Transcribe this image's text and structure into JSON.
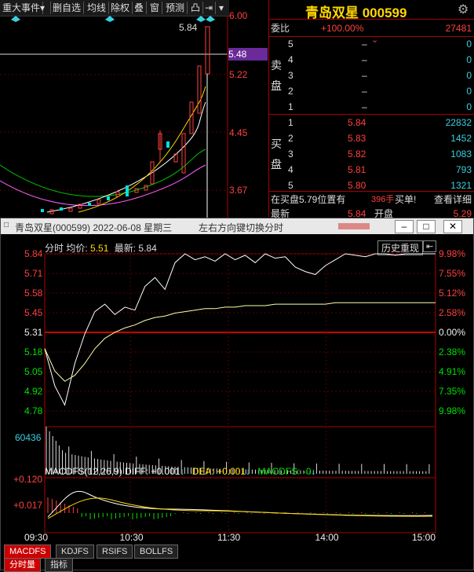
{
  "toolbar": {
    "items": [
      "重大事件",
      "删自选",
      "均线",
      "除权",
      "叠",
      "窗",
      "预测",
      "凸",
      "⇥"
    ]
  },
  "kline": {
    "price_labels": [
      "6.00",
      "5.48",
      "5.22",
      "4.45",
      "3.67"
    ],
    "peak_label": "5.84"
  },
  "stock": {
    "title": "青岛双星 000599"
  },
  "orderbook": {
    "weibi_label": "委比",
    "weibi_value": "+100.00%",
    "weicha_value": "27481",
    "sell_label": "卖盘",
    "buy_label": "买盘",
    "sells": [
      {
        "level": "5",
        "price": "–",
        "vol": "0"
      },
      {
        "level": "4",
        "price": "–",
        "vol": "0"
      },
      {
        "level": "3",
        "price": "–",
        "vol": "0"
      },
      {
        "level": "2",
        "price": "–",
        "vol": "0"
      },
      {
        "level": "1",
        "price": "–",
        "vol": "0"
      }
    ],
    "buys": [
      {
        "level": "1",
        "price": "5.84",
        "vol": "22832"
      },
      {
        "level": "2",
        "price": "5.83",
        "vol": "1452"
      },
      {
        "level": "3",
        "price": "5.82",
        "vol": "1083"
      },
      {
        "level": "4",
        "price": "5.81",
        "vol": "793"
      },
      {
        "level": "5",
        "price": "5.80",
        "vol": "1321"
      }
    ],
    "bottom_text": "在买盘5.79位置有",
    "bottom_qty": "396手",
    "bottom_action": "买单!",
    "bottom_link": "查看详细",
    "latest_label": "最新",
    "latest_value": "5.84",
    "open_label": "开盘",
    "open_value": "5.29"
  },
  "popup": {
    "title": "青岛双星(000599) 2022-06-08 星期三",
    "hint": "左右方向键切换分时",
    "history_button": "历史重现",
    "info_label": "分时 均价:",
    "avg_price": "5.51",
    "latest_label": "最新:",
    "latest_price": "5.84"
  },
  "chart_data": {
    "type": "line",
    "title": "分时",
    "y_price_labels": [
      "5.84",
      "5.71",
      "5.58",
      "5.45",
      "5.31",
      "5.18",
      "5.05",
      "4.92",
      "4.78"
    ],
    "y_pct_labels": [
      "9.98%",
      "7.55%",
      "5.12%",
      "2.58%",
      "0.00%",
      "2.38%",
      "4.91%",
      "7.35%",
      "9.98%"
    ],
    "x_labels": [
      "09:30",
      "10:30",
      "11:30",
      "14:00",
      "15:00"
    ],
    "volume_label": "60436",
    "macd_label": "MACDFS(12,26,9)",
    "diff_label": "DIFF: +0.001",
    "dea_label": "DEA: +0.001",
    "macd_value_label": "MACDFS: -0",
    "macd_y_labels": [
      "+0.120",
      "+0.017"
    ],
    "ylim": [
      4.78,
      5.84
    ],
    "series": [
      {
        "name": "price",
        "values": [
          5.2,
          4.95,
          4.82,
          5.1,
          5.3,
          5.45,
          5.5,
          5.43,
          5.48,
          5.46,
          5.62,
          5.68,
          5.6,
          5.78,
          5.84,
          5.8,
          5.82,
          5.79,
          5.84,
          5.8,
          5.83,
          5.78,
          5.84,
          5.81,
          5.82,
          5.75,
          5.72,
          5.7,
          5.76,
          5.8,
          5.84,
          5.83,
          5.82,
          5.84,
          5.84,
          5.83,
          5.84,
          5.84,
          5.84,
          5.84
        ]
      },
      {
        "name": "avg",
        "values": [
          5.2,
          5.05,
          4.98,
          5.02,
          5.1,
          5.2,
          5.27,
          5.31,
          5.34,
          5.36,
          5.39,
          5.41,
          5.42,
          5.44,
          5.45,
          5.46,
          5.47,
          5.47,
          5.48,
          5.48,
          5.49,
          5.49,
          5.49,
          5.5,
          5.5,
          5.5,
          5.5,
          5.5,
          5.5,
          5.51,
          5.51,
          5.51,
          5.51,
          5.51,
          5.51,
          5.51,
          5.51,
          5.51,
          5.51,
          5.51
        ]
      }
    ]
  },
  "tabs": [
    "MACDFS",
    "KDJFS",
    "RSIFS",
    "BOLLFS"
  ],
  "bottom_tabs": [
    "分时量",
    "指标"
  ]
}
